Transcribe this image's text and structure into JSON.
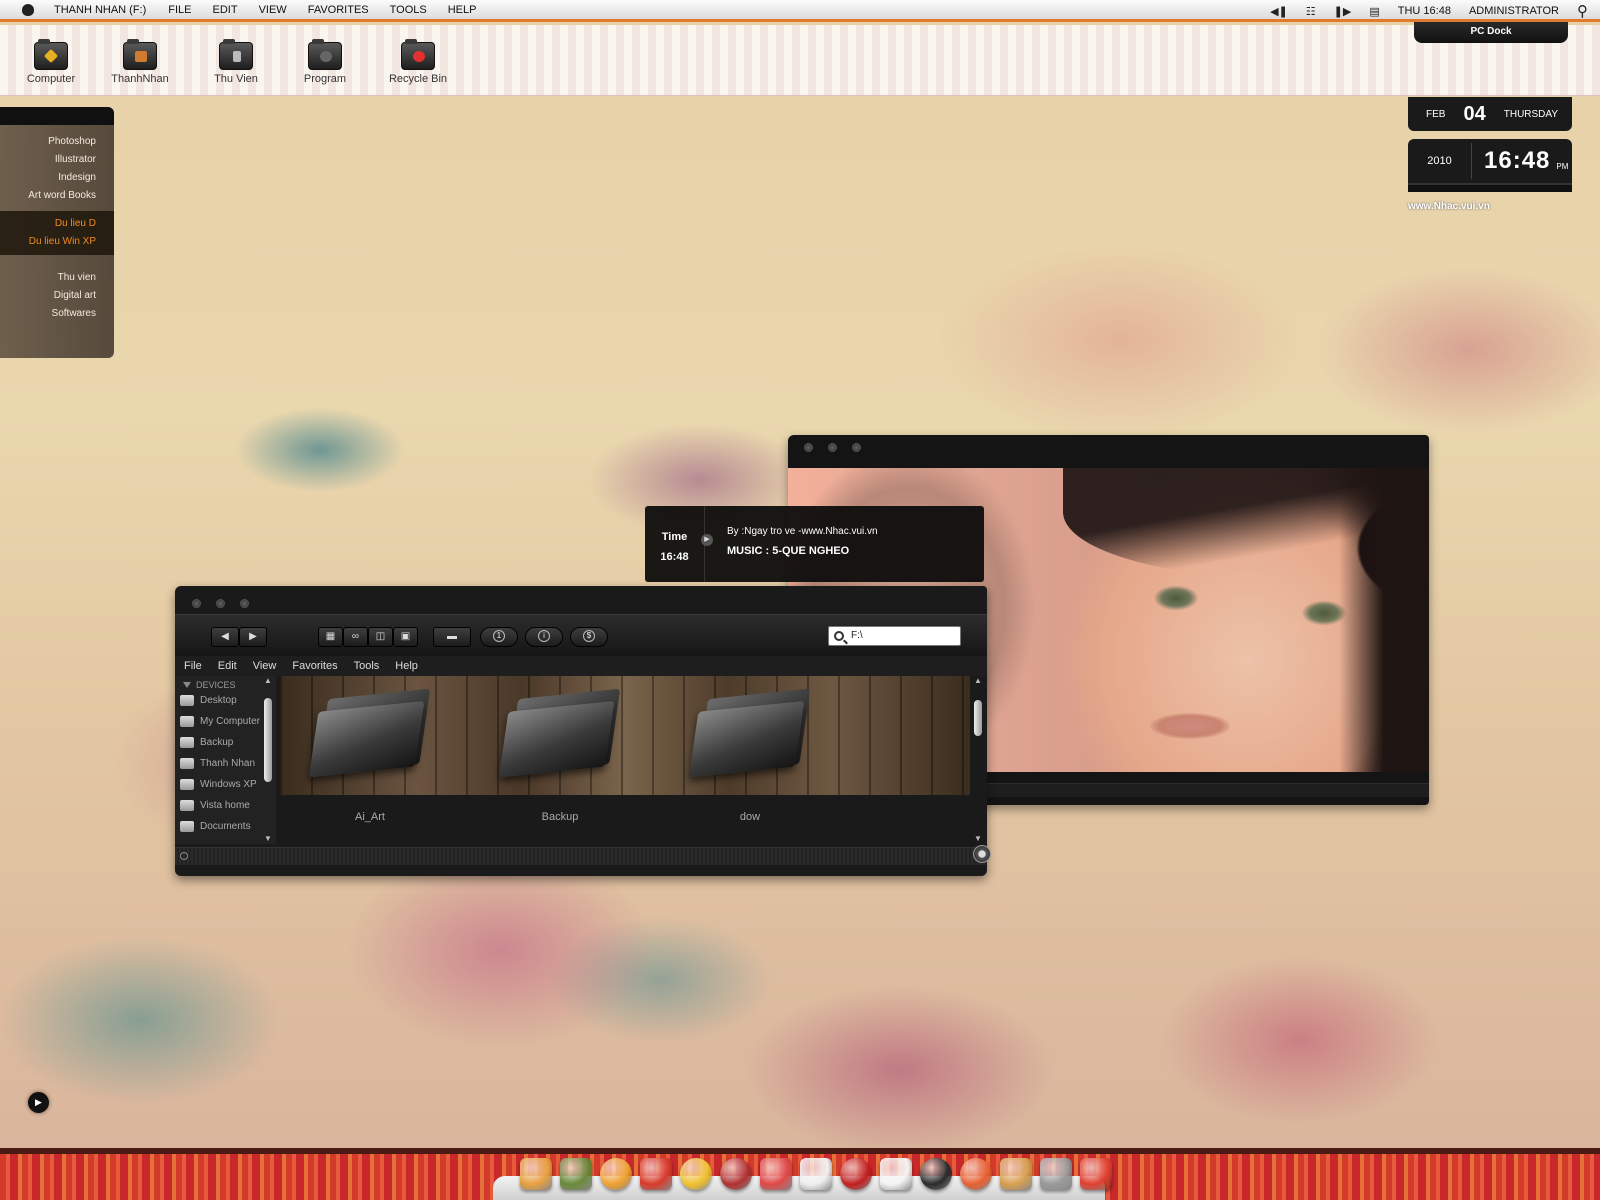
{
  "menubar": {
    "app_name": "THANH NHAN (F:)",
    "menus": [
      "FILE",
      "EDIT",
      "VIEW",
      "FAVORITES",
      "TOOLS",
      "HELP"
    ],
    "clock": "THU 16:48",
    "user": "ADMINISTRATOR",
    "icons": [
      "apple-icon",
      "previous-icon",
      "playlist-icon",
      "next-icon",
      "messages-icon",
      "search-icon"
    ]
  },
  "topstrip": {
    "items": [
      {
        "label": "Computer",
        "icon": "computer-folder-icon",
        "accent": "#e8b020"
      },
      {
        "label": "ThanhNhan",
        "icon": "pictures-folder-icon",
        "accent": "#d07a30"
      },
      {
        "label": "Thu Vien",
        "icon": "library-folder-icon",
        "accent": "#bbbbbb"
      },
      {
        "label": "Program",
        "icon": "program-folder-icon",
        "accent": "#666666"
      },
      {
        "label": "Recycle Bin",
        "icon": "recycle-bin-icon",
        "accent": "#e03030"
      }
    ],
    "pc_dock": "PC Dock"
  },
  "launcher": {
    "group1": [
      "Photoshop",
      "Illustrator",
      "Indesign",
      "Art word Books"
    ],
    "group2": [
      "Du lieu D",
      "Du lieu Win XP"
    ],
    "group3": [
      "Thu vien",
      "Digital art",
      "Softwares"
    ]
  },
  "clock_widget": {
    "month": "FEB",
    "day": "04",
    "weekday": "THURSDAY",
    "year": "2010",
    "time": "16:48",
    "ampm": "PM",
    "site": "www.Nhac.vui.vn"
  },
  "ticker": {
    "label": "Time",
    "time": "16:48",
    "by": "By :Ngay tro ve -www.Nhac.vui.vn",
    "song": "MUSIC : 5-QUE NGHEO"
  },
  "explorer": {
    "search_value": "F:\\",
    "menu": [
      "File",
      "Edit",
      "View",
      "Favorites",
      "Tools",
      "Help"
    ],
    "sidebar_header": "DEVICES",
    "sidebar": [
      "Desktop",
      "My Computer",
      "Backup",
      "Thanh Nhan",
      "Windows XP",
      "Vista home",
      "Documents"
    ],
    "folders": [
      "Ai_Art",
      "Backup",
      "dow"
    ],
    "toolbar_badges": [
      "1",
      "i",
      "$"
    ]
  },
  "dock": {
    "apps": [
      {
        "icon": "home-icon",
        "color": "#e8a040"
      },
      {
        "icon": "notebook-icon",
        "color": "#6a8a3a"
      },
      {
        "icon": "lollipop-icon",
        "color": "#f0a030"
      },
      {
        "icon": "bus-icon",
        "color": "#d83a2a"
      },
      {
        "icon": "alarm-clock-icon",
        "color": "#f0c030"
      },
      {
        "icon": "ball-icon",
        "color": "#b03030"
      },
      {
        "icon": "pinwheel-icon",
        "color": "#e04848"
      },
      {
        "icon": "stormtrooper-icon",
        "color": "#f0f0f0"
      },
      {
        "icon": "gauge-icon",
        "color": "#c02020"
      },
      {
        "icon": "tea-cup-icon",
        "color": "#f4f4f4"
      },
      {
        "icon": "camera-lens-icon",
        "color": "#2a2a2a"
      },
      {
        "icon": "beach-ball-icon",
        "color": "#e86030"
      },
      {
        "icon": "clipboard-icon",
        "color": "#d8a050"
      },
      {
        "icon": "tools-icon",
        "color": "#9a9a9a"
      },
      {
        "icon": "umbrella-icon",
        "color": "#e04030"
      }
    ]
  }
}
